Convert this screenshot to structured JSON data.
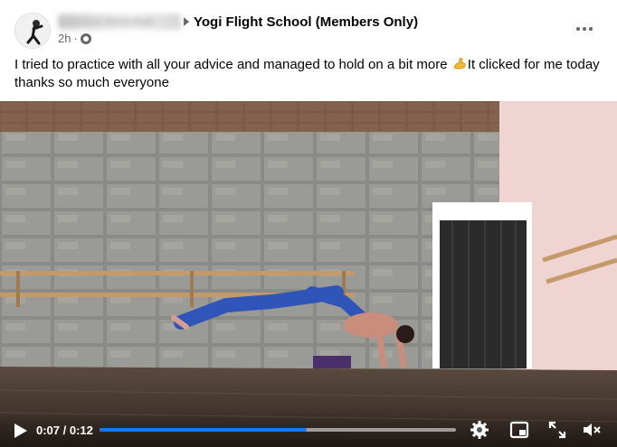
{
  "post": {
    "author_name": "Sabrina Abdullah",
    "group_name": "Yogi Flight School (Members Only)",
    "timestamp": "2h",
    "dot": "·",
    "audience_icon": "globe-icon",
    "more_icon": "more-options-icon",
    "text_before_emoji": "I tried to practice with all your advice and managed to hold on a bit more ",
    "emoji": "flexed-biceps-emoji",
    "text_after_emoji": "It clicked for me today thanks so much everyone"
  },
  "video": {
    "play_icon": "play-icon",
    "current_time": "0:07",
    "time_separator": " / ",
    "duration": "0:12",
    "progress_fraction": 0.58,
    "accent_color": "#1877f2",
    "control_icons": [
      "settings-gear-icon",
      "picture-in-picture-icon",
      "fullscreen-icon",
      "volume-muted-icon"
    ]
  }
}
